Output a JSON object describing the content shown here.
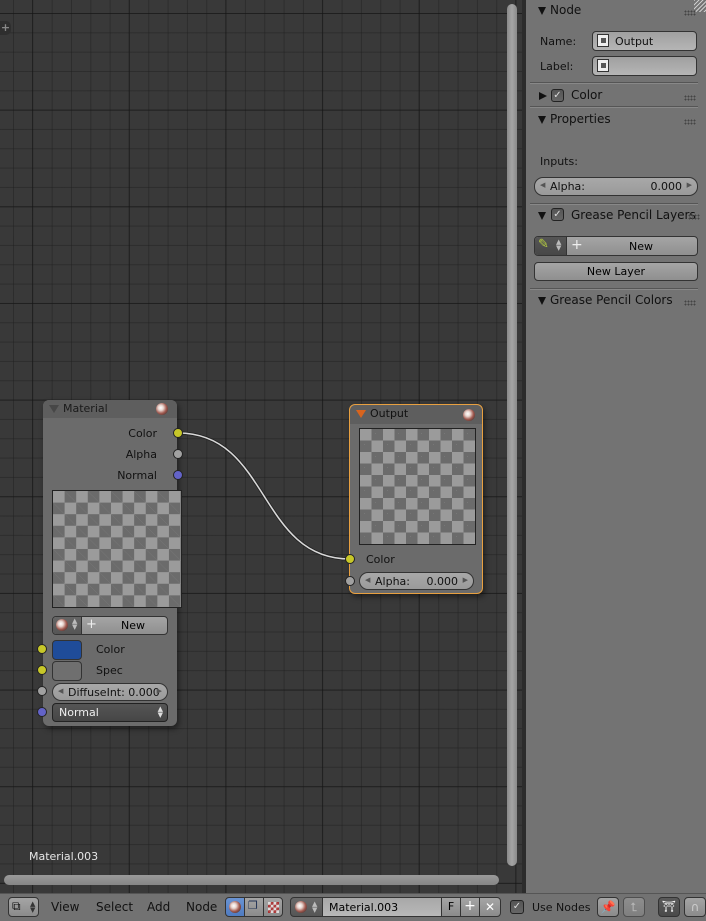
{
  "editor": {
    "material_label": "Material.003",
    "add_tab_icon": "plus-icon"
  },
  "nodes": {
    "material": {
      "title": "Material",
      "outputs": [
        {
          "label": "Color",
          "socket_color": "#c7c729"
        },
        {
          "label": "Alpha",
          "socket_color": "#a1a1a1"
        },
        {
          "label": "Normal",
          "socket_color": "#6363c7"
        }
      ],
      "new_button": "New",
      "inputs": {
        "color_label": "Color",
        "color_swatch": "#1f4c99",
        "spec_label": "Spec",
        "spec_swatch": "#6f6f6f",
        "diffuse_field": "DiffuseInt: 0.000",
        "normal_select": "Normal"
      }
    },
    "output": {
      "title": "Output",
      "color_label": "Color",
      "alpha_label": "Alpha:",
      "alpha_value": "0.000",
      "selected_outline": "#e8a040"
    },
    "link": {
      "from": "Material.Color",
      "to": "Output.Color"
    }
  },
  "panel": {
    "node_section": {
      "title": "Node",
      "name_label": "Name:",
      "name_value": "Output",
      "label_label": "Label:",
      "label_value": ""
    },
    "color_section": {
      "title": "Color",
      "checked": true,
      "collapsed": true
    },
    "properties_section": {
      "title": "Properties",
      "inputs_label": "Inputs:",
      "alpha_label": "Alpha:",
      "alpha_value": "0.000"
    },
    "gp_layers_section": {
      "title": "Grease Pencil Layers",
      "checked": true,
      "new_button": "New",
      "new_layer_button": "New Layer"
    },
    "gp_colors_section": {
      "title": "Grease Pencil Colors"
    }
  },
  "bottom_bar": {
    "menus": [
      "View",
      "Select",
      "Add",
      "Node"
    ],
    "material_name": "Material.003",
    "fake_user": "F",
    "use_nodes_label": "Use Nodes",
    "use_nodes_checked": true
  }
}
